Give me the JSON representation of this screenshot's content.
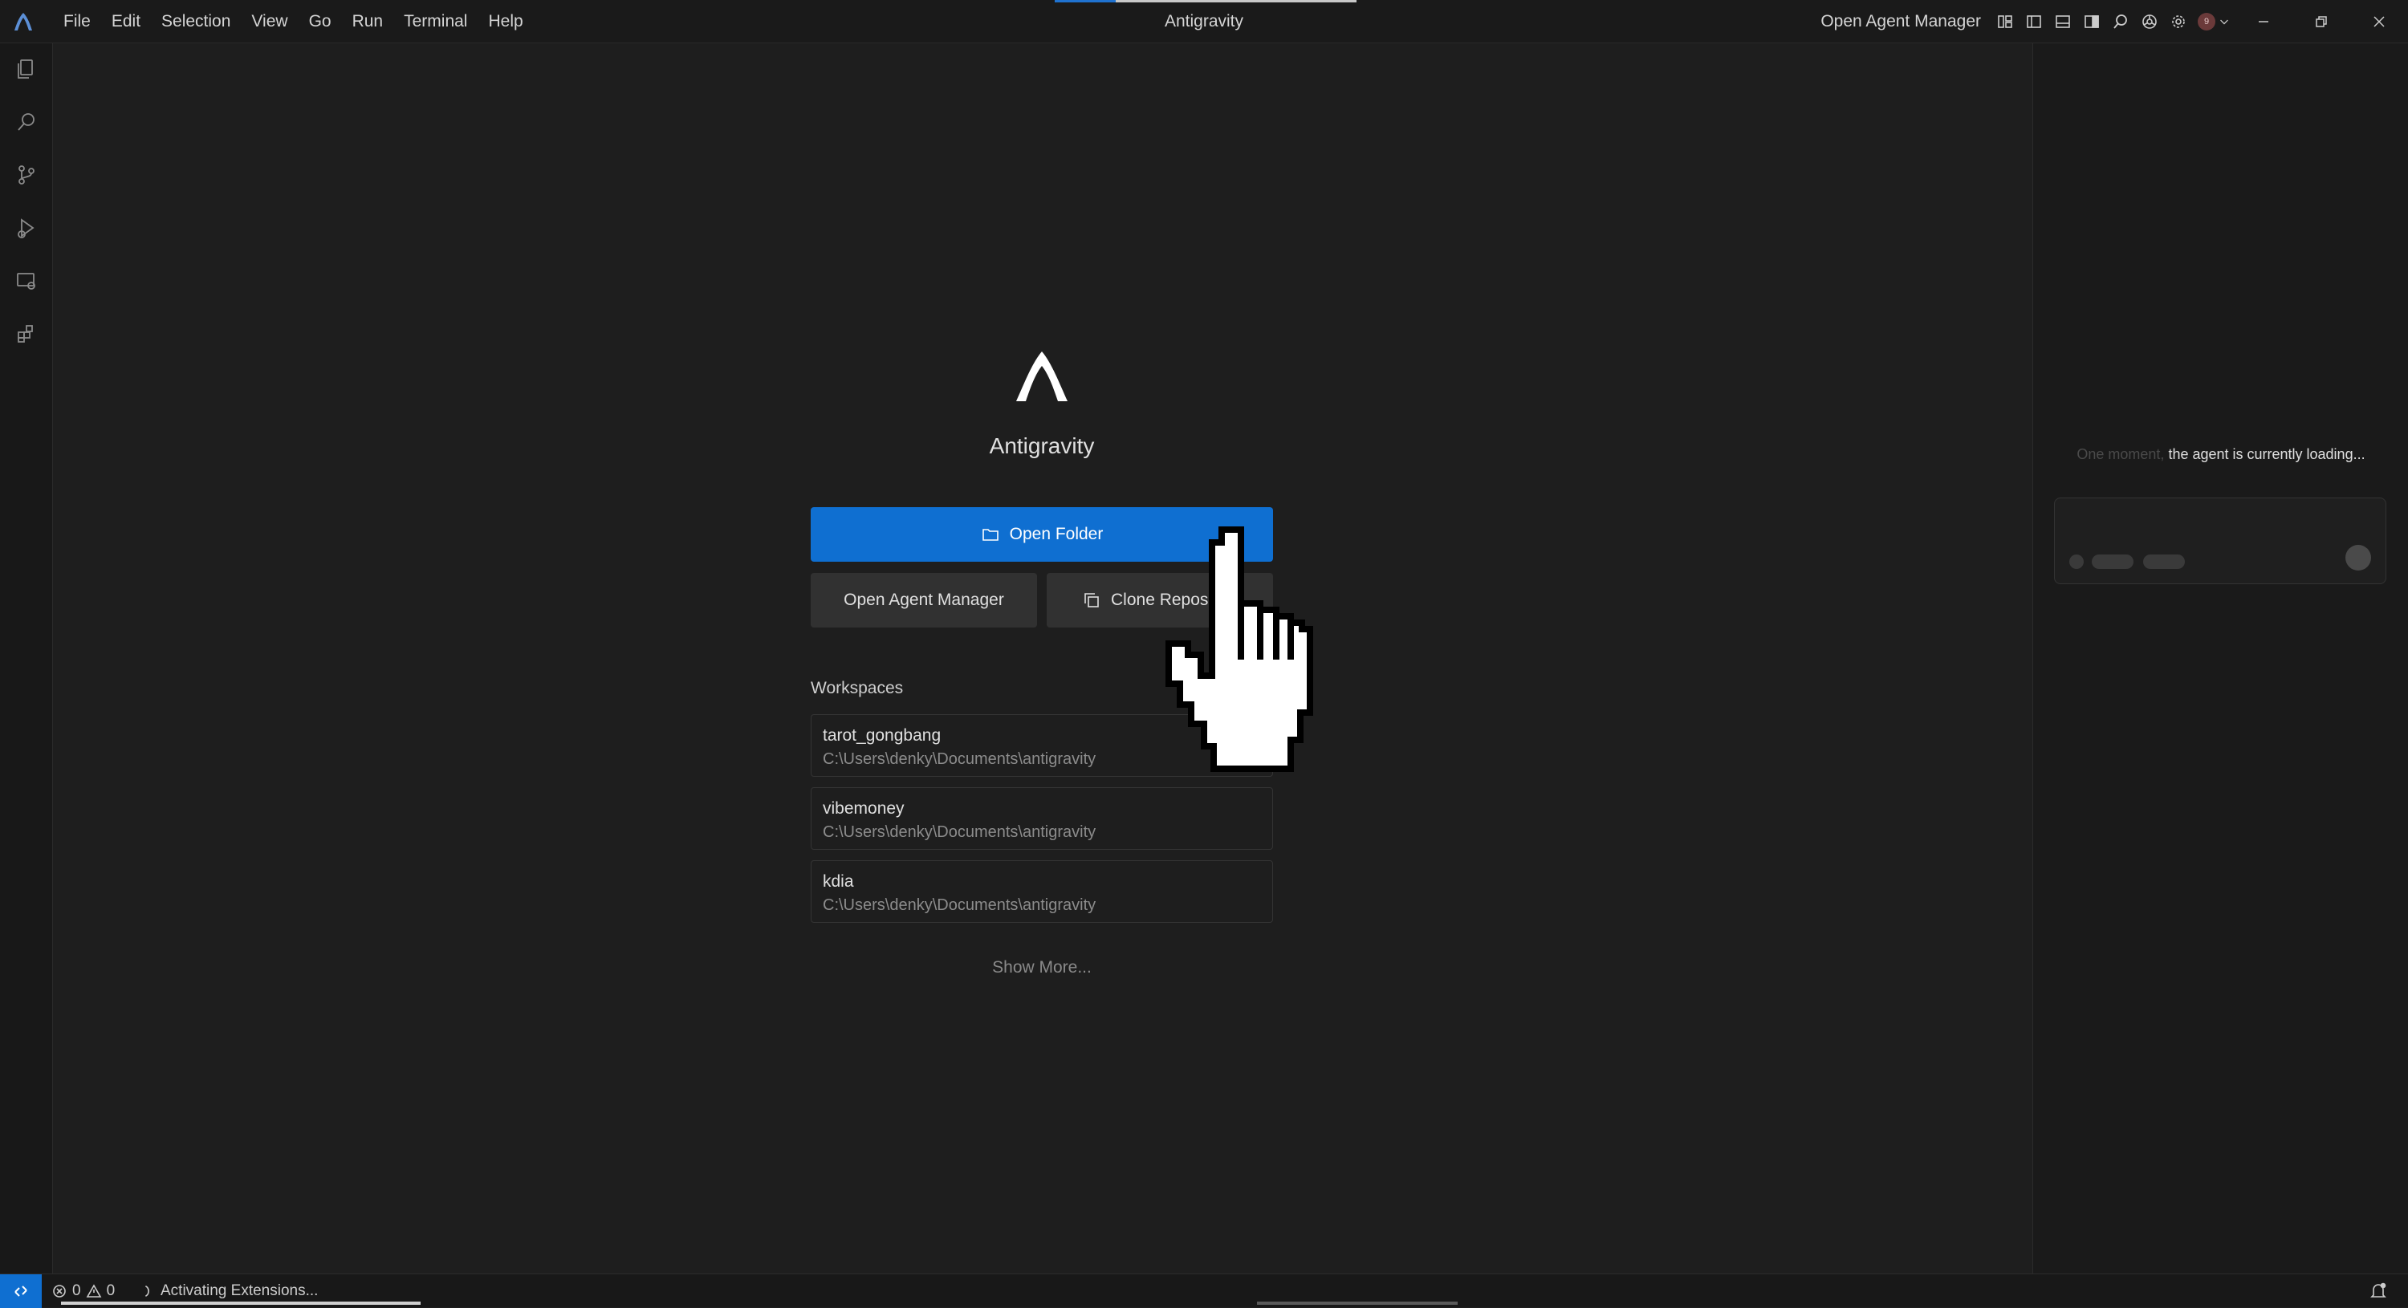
{
  "window": {
    "title": "Antigravity",
    "menu": [
      "File",
      "Edit",
      "Selection",
      "View",
      "Go",
      "Run",
      "Terminal",
      "Help"
    ],
    "agent_manager_link": "Open Agent Manager",
    "avatar_badge": "9"
  },
  "welcome": {
    "app_name": "Antigravity",
    "open_folder_label": "Open Folder",
    "open_agent_manager_label": "Open Agent Manager",
    "clone_repo_label": "Clone Repository",
    "workspaces_heading": "Workspaces",
    "workspaces": [
      {
        "name": "tarot_gongbang",
        "path": "C:\\Users\\denky\\Documents\\antigravity"
      },
      {
        "name": "vibemoney",
        "path": "C:\\Users\\denky\\Documents\\antigravity"
      },
      {
        "name": "kdia",
        "path": "C:\\Users\\denky\\Documents\\antigravity"
      }
    ],
    "show_more_label": "Show More..."
  },
  "agent_panel": {
    "loading_faded": "One moment,",
    "loading_text": " the agent is currently loading..."
  },
  "statusbar": {
    "errors": "0",
    "warnings": "0",
    "activity": "Activating Extensions..."
  },
  "colors": {
    "accent": "#0f6fd1",
    "background": "#1e1e1e",
    "sidebar": "#181818"
  }
}
